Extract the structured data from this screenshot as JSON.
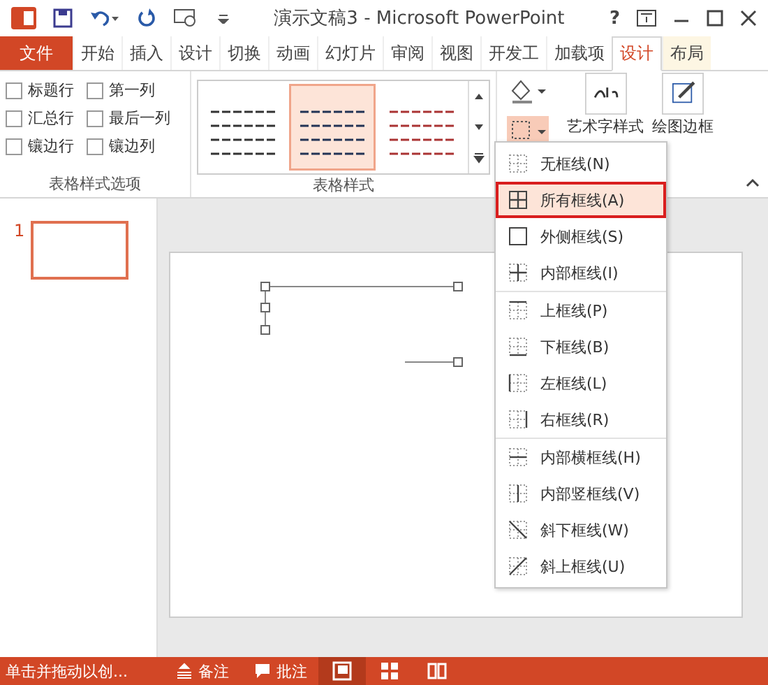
{
  "window": {
    "title": "演示文稿3 - Microsoft PowerPoint",
    "help": "?"
  },
  "ribbon_tabs": [
    {
      "label": "文件",
      "kind": "file",
      "selected": false
    },
    {
      "label": "开始",
      "kind": "normal",
      "selected": false
    },
    {
      "label": "插入",
      "kind": "normal",
      "selected": false
    },
    {
      "label": "设计",
      "kind": "normal",
      "selected": false
    },
    {
      "label": "切换",
      "kind": "normal",
      "selected": false
    },
    {
      "label": "动画",
      "kind": "normal",
      "selected": false
    },
    {
      "label": "幻灯片",
      "kind": "normal",
      "selected": false
    },
    {
      "label": "审阅",
      "kind": "normal",
      "selected": false
    },
    {
      "label": "视图",
      "kind": "normal",
      "selected": false
    },
    {
      "label": "开发工",
      "kind": "normal",
      "selected": false
    },
    {
      "label": "加载项",
      "kind": "normal",
      "selected": false
    },
    {
      "label": "设计",
      "kind": "contextual",
      "selected": true
    },
    {
      "label": "布局",
      "kind": "contextual",
      "selected": false
    }
  ],
  "style_options": {
    "title": "表格样式选项",
    "options": [
      {
        "label": "标题行",
        "checked": false
      },
      {
        "label": "第一列",
        "checked": false
      },
      {
        "label": "汇总行",
        "checked": false
      },
      {
        "label": "最后一列",
        "checked": false
      },
      {
        "label": "镶边行",
        "checked": false
      },
      {
        "label": "镶边列",
        "checked": false
      }
    ]
  },
  "table_styles": {
    "title": "表格样式",
    "styles": [
      {
        "selected": false
      },
      {
        "selected": true
      },
      {
        "selected": false
      }
    ]
  },
  "big_buttons": [
    {
      "label": "艺术字样式"
    },
    {
      "label": "绘图边框"
    }
  ],
  "border_menu": {
    "groups": [
      {
        "items": [
          {
            "label": "无框线(N)",
            "selected": false
          },
          {
            "label": "所有框线(A)",
            "selected": true
          },
          {
            "label": "外侧框线(S)",
            "selected": false
          },
          {
            "label": "内部框线(I)",
            "selected": false
          }
        ]
      },
      {
        "items": [
          {
            "label": "上框线(P)",
            "selected": false
          },
          {
            "label": "下框线(B)",
            "selected": false
          },
          {
            "label": "左框线(L)",
            "selected": false
          },
          {
            "label": "右框线(R)",
            "selected": false
          }
        ]
      },
      {
        "items": [
          {
            "label": "内部横框线(H)",
            "selected": false
          },
          {
            "label": "内部竖框线(V)",
            "selected": false
          },
          {
            "label": "斜下框线(W)",
            "selected": false
          },
          {
            "label": "斜上框线(U)",
            "selected": false
          }
        ]
      }
    ]
  },
  "slides": [
    {
      "number": "1",
      "selected": true
    }
  ],
  "status_bar": {
    "hint": "单击并拖动以创...",
    "buttons": [
      {
        "label": "备注",
        "kind": "notes"
      },
      {
        "label": "批注",
        "kind": "comment"
      }
    ],
    "views": [
      {
        "kind": "normal",
        "selected": true
      },
      {
        "kind": "sorter",
        "selected": false
      },
      {
        "kind": "reading",
        "selected": false
      }
    ]
  }
}
